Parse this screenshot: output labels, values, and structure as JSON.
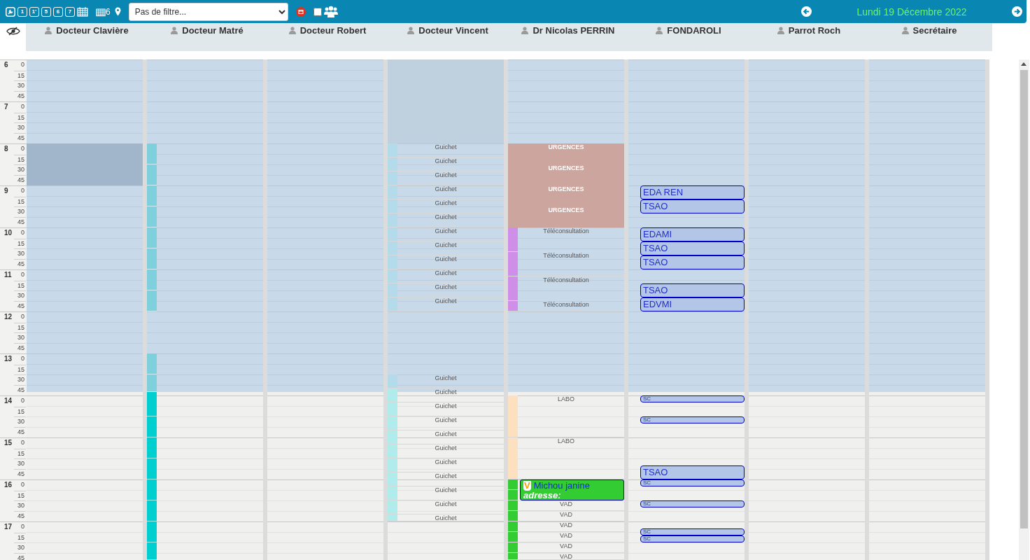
{
  "toolbar": {
    "view_buttons": [
      "1",
      "1'",
      "5",
      "6",
      "7"
    ],
    "calendar_count": "6",
    "filter": {
      "value": "Pas de filtre..."
    },
    "checkbox": {
      "checked": false
    },
    "date": "Lundi 19 Décembre 2022"
  },
  "hours": [
    {
      "hour": "6",
      "minutes": [
        "0",
        "15",
        "30",
        "45"
      ]
    },
    {
      "hour": "7",
      "minutes": [
        "0",
        "15",
        "30",
        "45"
      ]
    },
    {
      "hour": "8",
      "minutes": [
        "0",
        "15",
        "30",
        "45"
      ]
    },
    {
      "hour": "9",
      "minutes": [
        "0",
        "15",
        "30",
        "45"
      ]
    },
    {
      "hour": "10",
      "minutes": [
        "0",
        "15",
        "30",
        "45"
      ]
    },
    {
      "hour": "11",
      "minutes": [
        "0",
        "15",
        "30",
        "45"
      ]
    },
    {
      "hour": "12",
      "minutes": [
        "0",
        "15",
        "30",
        "45"
      ]
    },
    {
      "hour": "13",
      "minutes": [
        "0",
        "15",
        "30",
        "45"
      ]
    },
    {
      "hour": "14",
      "minutes": [
        "0",
        "15",
        "30",
        "45"
      ]
    },
    {
      "hour": "15",
      "minutes": [
        "0",
        "15",
        "30",
        "45"
      ]
    },
    {
      "hour": "16",
      "minutes": [
        "0",
        "15",
        "30",
        "45"
      ]
    },
    {
      "hour": "17",
      "minutes": [
        "0",
        "15",
        "30",
        "45"
      ]
    }
  ],
  "columns": [
    {
      "name": "Docteur Clavière",
      "events": [
        {
          "kind": "block",
          "color": "#a1b6cb"
        }
      ]
    },
    {
      "name": "Docteur Matré",
      "events": [
        {
          "kind": "strip",
          "color": "#7fd0dd"
        },
        {
          "kind": "strip",
          "color": "#7fd0dd"
        },
        {
          "kind": "strip",
          "color": "#7fd0dd"
        },
        {
          "kind": "strip",
          "color": "#7fd0dd"
        },
        {
          "kind": "strip",
          "color": "#7fd0dd"
        },
        {
          "kind": "strip",
          "color": "#7fd0dd"
        },
        {
          "kind": "strip",
          "color": "#7fd0dd"
        },
        {
          "kind": "strip",
          "color": "#7fd0dd"
        },
        {
          "kind": "strip",
          "color": "#7fd0dd"
        },
        {
          "kind": "strip",
          "color": "#7fd0dd"
        },
        {
          "kind": "strip",
          "color": "#00cfd0"
        },
        {
          "kind": "strip",
          "color": "#00cfd0"
        },
        {
          "kind": "strip",
          "color": "#00cfd0"
        },
        {
          "kind": "strip",
          "color": "#00cfd0"
        },
        {
          "kind": "strip",
          "color": "#00cfd0"
        },
        {
          "kind": "strip",
          "color": "#00cfd0"
        },
        {
          "kind": "strip",
          "color": "#00cfd0"
        },
        {
          "kind": "strip",
          "color": "#00cfd0"
        }
      ]
    },
    {
      "name": "Docteur Robert"
    },
    {
      "name": "Docteur Vincent",
      "events": [
        {
          "kind": "block",
          "color": "#bfd0de"
        },
        {
          "kind": "slot",
          "color": "#b3dbe9",
          "label": "Guichet"
        },
        {
          "kind": "slot",
          "color": "#b3dbe9",
          "label": "Guichet"
        },
        {
          "kind": "slot",
          "color": "#b3dbe9",
          "label": "Guichet"
        },
        {
          "kind": "slot",
          "color": "#b3dbe9",
          "label": "Guichet"
        },
        {
          "kind": "slot",
          "color": "#b3dbe9",
          "label": "Guichet"
        },
        {
          "kind": "slot",
          "color": "#b3dbe9",
          "label": "Guichet"
        },
        {
          "kind": "slot",
          "color": "#b3dbe9",
          "label": "Guichet"
        },
        {
          "kind": "slot",
          "color": "#b3dbe9",
          "label": "Guichet"
        },
        {
          "kind": "slot",
          "color": "#b3dbe9",
          "label": "Guichet"
        },
        {
          "kind": "slot",
          "color": "#b3dbe9",
          "label": "Guichet"
        },
        {
          "kind": "slot",
          "color": "#b3dbe9",
          "label": "Guichet"
        },
        {
          "kind": "slot",
          "color": "#b3dbe9",
          "label": "Guichet"
        },
        {
          "kind": "slot",
          "color": "#b3dbe9",
          "label": "Guichet"
        },
        {
          "kind": "slot",
          "color": "#b0ecec",
          "label": "Guichet"
        },
        {
          "kind": "slot",
          "color": "#b0ecec",
          "label": "Guichet"
        },
        {
          "kind": "slot",
          "color": "#b0ecec",
          "label": "Guichet"
        },
        {
          "kind": "slot",
          "color": "#b0ecec",
          "label": "Guichet"
        },
        {
          "kind": "slot",
          "color": "#b0ecec",
          "label": "Guichet"
        },
        {
          "kind": "slot",
          "color": "#b0ecec",
          "label": "Guichet"
        },
        {
          "kind": "slot",
          "color": "#b0ecec",
          "label": "Guichet"
        },
        {
          "kind": "slot",
          "color": "#b0ecec",
          "label": "Guichet"
        },
        {
          "kind": "slot",
          "color": "#b0ecec",
          "label": "Guichet"
        },
        {
          "kind": "slot",
          "color": "#b0ecec",
          "label": "Guichet"
        }
      ]
    },
    {
      "name": "Dr Nicolas PERRIN",
      "events": [
        {
          "kind": "block",
          "color": "#cda59f",
          "label": "URGENCES"
        },
        {
          "kind": "block",
          "color": "#cda59f",
          "label": "URGENCES"
        },
        {
          "kind": "block",
          "color": "#cda59f",
          "label": "URGENCES"
        },
        {
          "kind": "block",
          "color": "#cda59f",
          "label": "URGENCES"
        },
        {
          "kind": "slot",
          "color": "#cf8fe9",
          "label": "Téléconsultation"
        },
        {
          "kind": "slot",
          "color": "#cf8fe9",
          "label": "Téléconsultation"
        },
        {
          "kind": "slot",
          "color": "#cf8fe9",
          "label": "Téléconsultation"
        },
        {
          "kind": "slot",
          "color": "#cf8fe9",
          "label": "Téléconsultation"
        },
        {
          "kind": "slot",
          "color": "#fde0c0",
          "label": "LABO"
        },
        {
          "kind": "slot",
          "color": "#fde0c0",
          "label": "LABO"
        },
        {
          "kind": "strip",
          "color": "#33cc33"
        },
        {
          "kind": "strip",
          "color": "#33cc33"
        },
        {
          "kind": "patient",
          "color": "#33cc33",
          "badge": "V",
          "label": "Michou janine",
          "address": "adresse:"
        },
        {
          "kind": "slot",
          "color": "#33cc33",
          "label": "VAD"
        },
        {
          "kind": "slot",
          "color": "#33cc33",
          "label": "VAD"
        },
        {
          "kind": "slot",
          "color": "#33cc33",
          "label": "VAD"
        },
        {
          "kind": "slot",
          "color": "#33cc33",
          "label": "VAD"
        },
        {
          "kind": "slot",
          "color": "#33cc33",
          "label": "VAD"
        },
        {
          "kind": "slot",
          "color": "#33cc33",
          "label": "VAD"
        }
      ]
    },
    {
      "name": "FONDAROLI",
      "events": [
        {
          "kind": "card",
          "color": "#b4c6e8",
          "label": "EDA REN"
        },
        {
          "kind": "card",
          "color": "#b4c6e8",
          "label": "TSAO"
        },
        {
          "kind": "card",
          "color": "#b4c6e8",
          "label": "EDAMI"
        },
        {
          "kind": "card",
          "color": "#b4c6e8",
          "label": "TSAO"
        },
        {
          "kind": "card",
          "color": "#b4c6e8",
          "label": "TSAO"
        },
        {
          "kind": "card",
          "color": "#b4c6e8",
          "label": "TSAO"
        },
        {
          "kind": "card",
          "color": "#b4c6e8",
          "label": "EDVMI"
        },
        {
          "kind": "card",
          "color": "#b4c6e8",
          "label": "SC"
        },
        {
          "kind": "card",
          "color": "#b4c6e8",
          "label": "SC"
        },
        {
          "kind": "card",
          "color": "#b4c6e8",
          "label": "TSAO"
        },
        {
          "kind": "card",
          "color": "#b4c6e8",
          "label": "SC"
        },
        {
          "kind": "card",
          "color": "#b4c6e8",
          "label": "SC"
        },
        {
          "kind": "card",
          "color": "#b4c6e8",
          "label": "SC"
        },
        {
          "kind": "card",
          "color": "#b4c6e8",
          "label": "SC"
        }
      ]
    },
    {
      "name": "Parrot Roch"
    },
    {
      "name": "Secrétaire"
    }
  ]
}
